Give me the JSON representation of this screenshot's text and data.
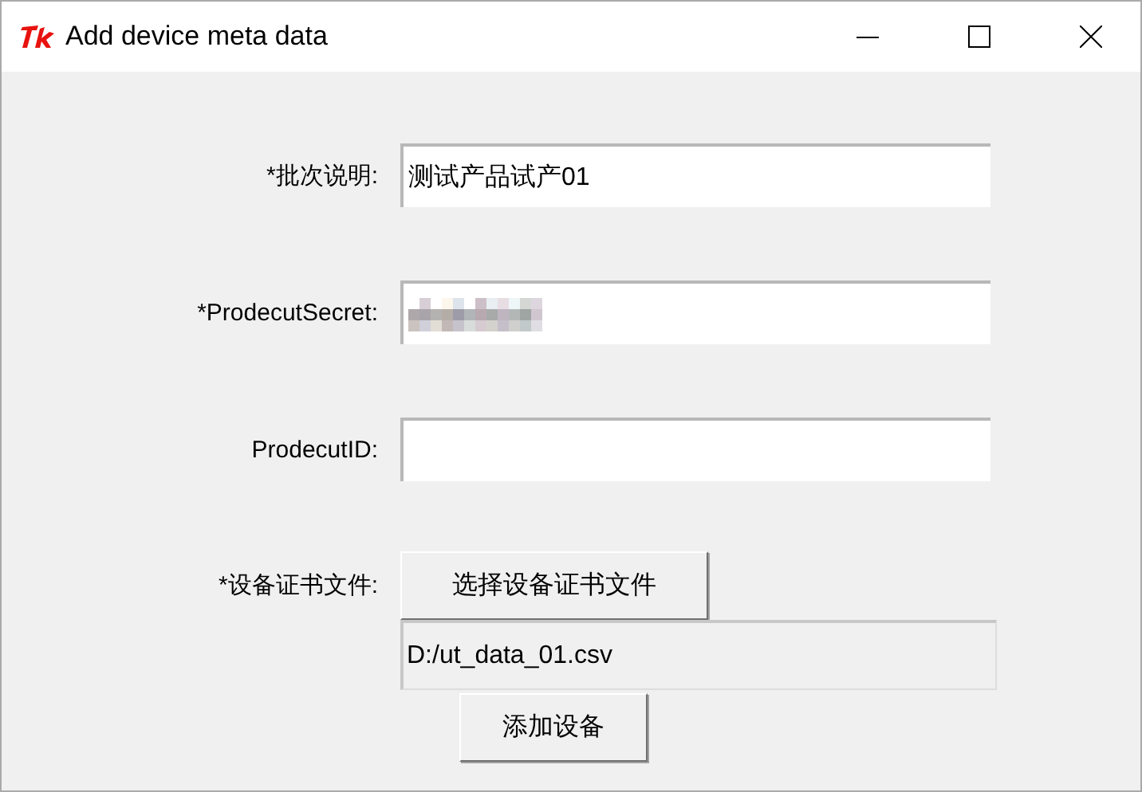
{
  "window": {
    "title": "Add device meta data"
  },
  "fields": [
    {
      "label": "*批次说明:",
      "value": "测试产品试产01",
      "redacted": false
    },
    {
      "label": "*ProdecutSecret:",
      "redacted": true
    },
    {
      "label": "ProdecutID:",
      "redacted": false
    }
  ],
  "file": {
    "label": "*设备证书文件:",
    "button": "选择设备证书文件",
    "path": "D:/ut_data_01.csv"
  },
  "submit": "添加设备"
}
